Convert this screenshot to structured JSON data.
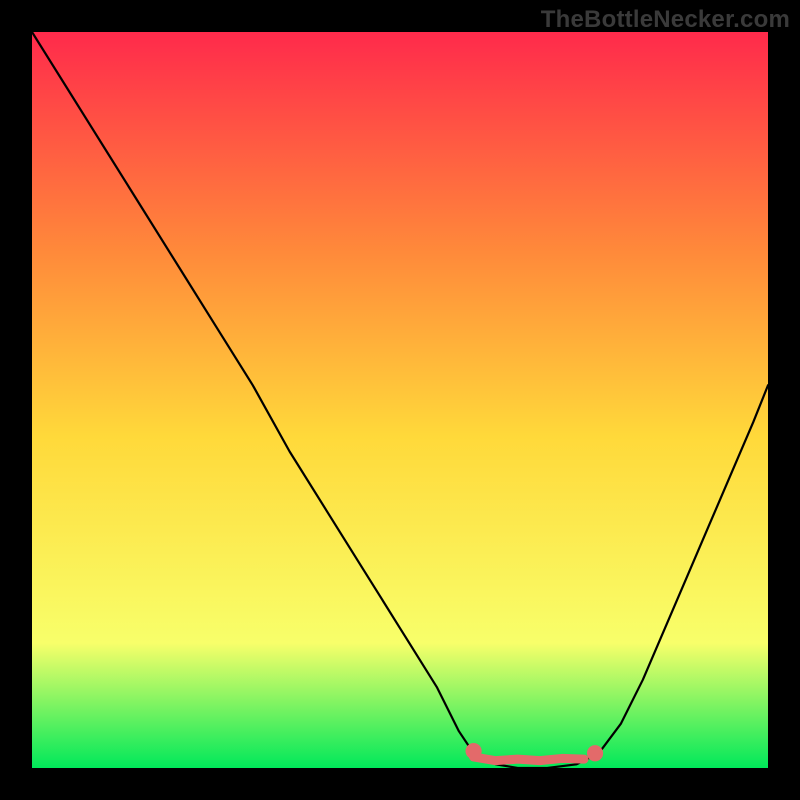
{
  "watermark": "TheBottleNecker.com",
  "chart_data": {
    "type": "line",
    "title": "",
    "xlabel": "",
    "ylabel": "",
    "xlim": [
      0,
      100
    ],
    "ylim": [
      0,
      100
    ],
    "grid": false,
    "background_gradient": {
      "top": "#ff2a4b",
      "mid_upper": "#ff8a3a",
      "mid": "#ffd93a",
      "mid_lower": "#f8ff6a",
      "bottom": "#00e85a"
    },
    "series": [
      {
        "name": "curve",
        "color": "#000000",
        "comment": "approximate trace of the visible black V-shaped curve; y is percent of plot height from bottom",
        "points": [
          {
            "x": 0,
            "y": 100
          },
          {
            "x": 5,
            "y": 92
          },
          {
            "x": 10,
            "y": 84
          },
          {
            "x": 15,
            "y": 76
          },
          {
            "x": 20,
            "y": 68
          },
          {
            "x": 25,
            "y": 60
          },
          {
            "x": 30,
            "y": 52
          },
          {
            "x": 35,
            "y": 43
          },
          {
            "x": 40,
            "y": 35
          },
          {
            "x": 45,
            "y": 27
          },
          {
            "x": 50,
            "y": 19
          },
          {
            "x": 55,
            "y": 11
          },
          {
            "x": 58,
            "y": 5
          },
          {
            "x": 60,
            "y": 2
          },
          {
            "x": 63,
            "y": 0.5
          },
          {
            "x": 66,
            "y": 0
          },
          {
            "x": 70,
            "y": 0
          },
          {
            "x": 74,
            "y": 0.5
          },
          {
            "x": 77,
            "y": 2
          },
          {
            "x": 80,
            "y": 6
          },
          {
            "x": 83,
            "y": 12
          },
          {
            "x": 86,
            "y": 19
          },
          {
            "x": 89,
            "y": 26
          },
          {
            "x": 92,
            "y": 33
          },
          {
            "x": 95,
            "y": 40
          },
          {
            "x": 98,
            "y": 47
          },
          {
            "x": 100,
            "y": 52
          }
        ]
      },
      {
        "name": "flat-marker",
        "color": "#e36a6a",
        "comment": "short flat wobble/marker near the trough",
        "points": [
          {
            "x": 60,
            "y": 1.5
          },
          {
            "x": 63,
            "y": 1.0
          },
          {
            "x": 66,
            "y": 1.2
          },
          {
            "x": 69,
            "y": 1.0
          },
          {
            "x": 72,
            "y": 1.3
          },
          {
            "x": 75,
            "y": 1.2
          }
        ]
      }
    ],
    "markers": [
      {
        "name": "dot-left",
        "x": 60,
        "y": 2.3,
        "r": 1.1,
        "color": "#e36a6a"
      },
      {
        "name": "dot-right",
        "x": 76.5,
        "y": 2.0,
        "r": 1.1,
        "color": "#e36a6a"
      }
    ]
  }
}
